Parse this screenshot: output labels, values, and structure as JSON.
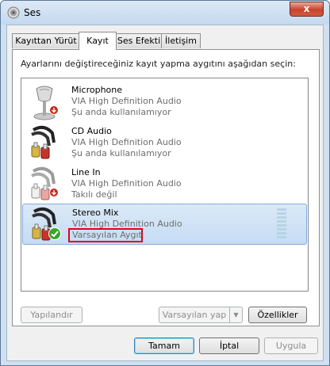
{
  "window": {
    "title": "Ses",
    "close_symbol": "x"
  },
  "tabs": [
    {
      "label": "Kayıttan Yürüt",
      "active": false
    },
    {
      "label": "Kayıt",
      "active": true
    },
    {
      "label": "Ses Efekti",
      "active": false
    },
    {
      "label": "İletişim",
      "active": false
    }
  ],
  "instruction": "Ayarlarını değiştireceğiniz kayıt yapma aygıtını aşağıdan seçin:",
  "devices": [
    {
      "name": "Microphone",
      "driver": "VIA High Definition Audio",
      "status": "Şu anda kullanılamıyor",
      "icon": "microphone-icon",
      "badge": "down-arrow-badge-icon"
    },
    {
      "name": "CD Audio",
      "driver": "VIA High Definition Audio",
      "status": "Şu anda kullanılamıyor",
      "icon": "rca-cable-icon",
      "badge": ""
    },
    {
      "name": "Line In",
      "driver": "VIA High Definition Audio",
      "status": "Takılı değil",
      "icon": "rca-cable-icon",
      "badge": "down-arrow-badge-icon"
    },
    {
      "name": "Stereo Mix",
      "driver": "VIA High Definition Audio",
      "status": "Varsayılan Aygıt",
      "icon": "rca-cable-icon",
      "badge": "green-check-badge-icon",
      "selected": true
    }
  ],
  "buttons": {
    "configure": "Yapılandır",
    "set_default": "Varsayılan yap",
    "properties": "Özellikler",
    "ok": "Tamam",
    "cancel": "İptal",
    "apply": "Uygula"
  },
  "colors": {
    "highlight_border": "#e3001b",
    "selection_bg": "#c5dcf3",
    "window_frame": "#cfe0f1"
  }
}
